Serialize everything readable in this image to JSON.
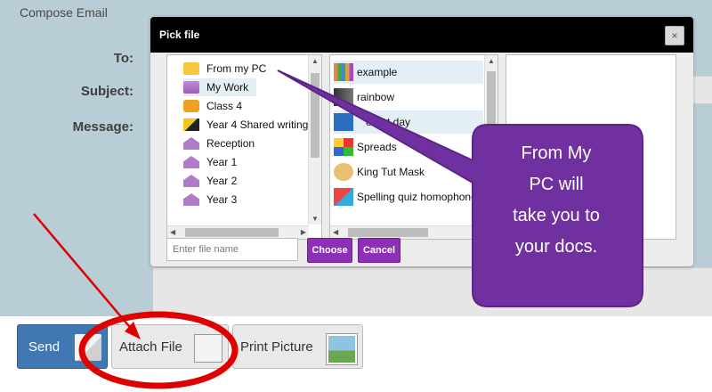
{
  "compose": {
    "title": "Compose Email",
    "to_label": "To:",
    "subject_label": "Subject:",
    "message_label": "Message:"
  },
  "dialog": {
    "title": "Pick file",
    "close_icon": "×",
    "folders": [
      {
        "label": "From my PC",
        "icon": "folder-icon"
      },
      {
        "label": "My Work",
        "icon": "folder-person-icon"
      },
      {
        "label": "Class 4",
        "icon": "people-icon"
      },
      {
        "label": "Year 4 Shared writing",
        "icon": "pencil-icon"
      },
      {
        "label": "Reception",
        "icon": "house-icon"
      },
      {
        "label": "Year 1",
        "icon": "house-icon"
      },
      {
        "label": "Year 2",
        "icon": "house-icon"
      },
      {
        "label": "Year 3",
        "icon": "house-icon"
      }
    ],
    "files": [
      {
        "label": "example",
        "icon": "thumb-example"
      },
      {
        "label": "rainbow",
        "icon": "thumb-rainbow"
      },
      {
        "label": "ernet day",
        "icon": "thumb-doc"
      },
      {
        "label": "Spreads",
        "icon": "thumb-sheet"
      },
      {
        "label": "King Tut Mask",
        "icon": "thumb-mask"
      },
      {
        "label": "Spelling quiz homophone",
        "icon": "thumb-quiz"
      }
    ],
    "filename_placeholder": "Enter file name",
    "choose_label": "Choose",
    "cancel_label": "Cancel"
  },
  "callout": {
    "lines": [
      "From My",
      "PC will",
      "take you to",
      "your docs."
    ],
    "color": "#7030a0"
  },
  "buttons": {
    "send_label": "Send",
    "attach_label": "Attach File",
    "print_label": "Print Picture"
  },
  "colors": {
    "accent_purple": "#8e2fb8",
    "send_blue": "#3f78b3",
    "annotation_red": "#e00000"
  }
}
